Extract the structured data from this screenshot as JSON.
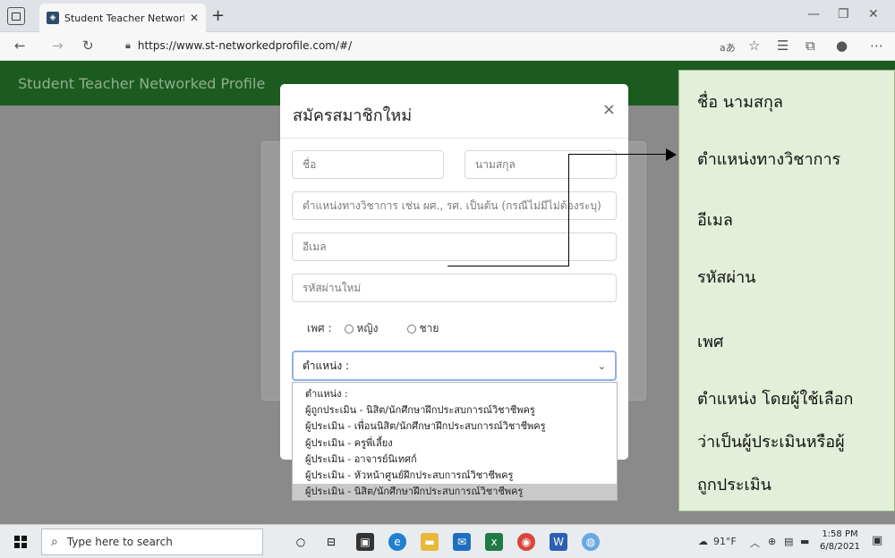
{
  "browser": {
    "tab_title": "Student Teacher Networked Profi",
    "url": "https://www.st-networkedprofile.com/#/",
    "toolbar_icons": [
      "back-icon",
      "forward-icon",
      "refresh-icon",
      "read-aloud-icon",
      "favorite-icon",
      "favorites-icon",
      "collections-icon",
      "profile-icon",
      "more-icon"
    ],
    "read_aloud_label": "aあ"
  },
  "page": {
    "brand": "Student Teacher Networked Profile"
  },
  "modal": {
    "title": "สมัครสมาชิกใหม่",
    "close": "×",
    "first_name_placeholder": "ชื่อ",
    "last_name_placeholder": "นามสกุล",
    "academic_title_placeholder": "ตำแหน่งทางวิชาการ เช่น ผศ., รศ. เป็นต้น (กรณีไม่มีไม่ต้องระบุ)",
    "email_placeholder": "อีเมล",
    "password_placeholder": "รหัสผ่านใหม่",
    "gender_label": "เพศ :",
    "gender_female": "หญิง",
    "gender_male": "ชาย",
    "position_selected": "ตำแหน่ง :"
  },
  "dropdown": {
    "options": [
      "ตำแหน่ง :",
      "ผู้ถูกประเมิน - นิสิต/นักศึกษาฝึกประสบการณ์วิชาชีพครู",
      "ผู้ประเมิน - เพื่อนนิสิต/นักศึกษาฝึกประสบการณ์วิชาชีพครู",
      "ผู้ประเมิน - ครูพี่เลี้ยง",
      "ผู้ประเมิน - อาจารย์นิเทศก์",
      "ผู้ประเมิน - หัวหน้าศูนย์ฝึกประสบการณ์วิชาชีพครู",
      "ผู้ประเมิน - นิสิต/นักศึกษาฝึกประสบการณ์วิชาชีพครู"
    ],
    "highlighted_index": 6
  },
  "annotation": {
    "line1": "ชื่อ นามสกุล",
    "line2": "ตำแหน่งทางวิชาการ",
    "line3": "อีเมล",
    "line4": "รหัสผ่าน",
    "line5": "เพศ",
    "line6": "ตำแหน่ง โดยผู้ใช้เลือก",
    "line7": "ว่าเป็นผู้ประเมินหรือผู้",
    "line8": "ถูกประเมิน"
  },
  "taskbar": {
    "search_placeholder": "Type here to search",
    "weather": "91°F",
    "time": "1:58 PM",
    "date": "6/8/2021"
  },
  "colors": {
    "navbar": "#1c5b1f",
    "overlay": "#8a8a8a",
    "note_bg": "#e3efd8",
    "select_focus": "#8fb0e8"
  }
}
